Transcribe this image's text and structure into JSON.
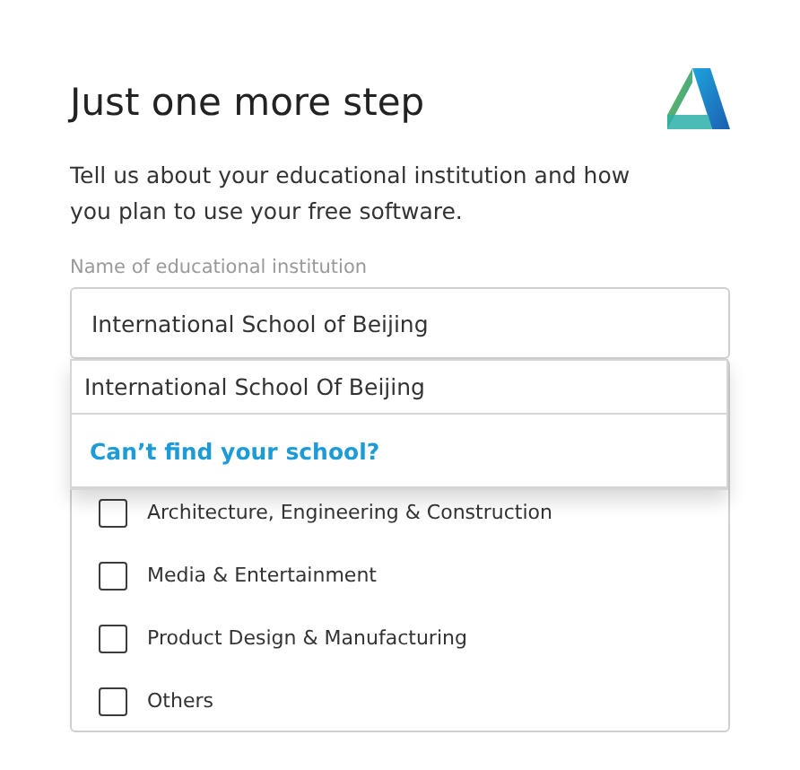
{
  "title": "Just one more step",
  "intro": "Tell us about your educational institution and how you plan to use your free software.",
  "institution_field": {
    "label": "Name of educational institution",
    "value": "International School of Beijing"
  },
  "suggestions": [
    {
      "kind": "option",
      "text": "International School Of Beijing"
    },
    {
      "kind": "link",
      "text": "Can’t find your school?"
    }
  ],
  "interests": [
    {
      "label": "Architecture, Engineering & Construction",
      "checked": false
    },
    {
      "label": "Media & Entertainment",
      "checked": false
    },
    {
      "label": "Product Design & Manufacturing",
      "checked": false
    },
    {
      "label": "Others",
      "checked": false
    }
  ]
}
